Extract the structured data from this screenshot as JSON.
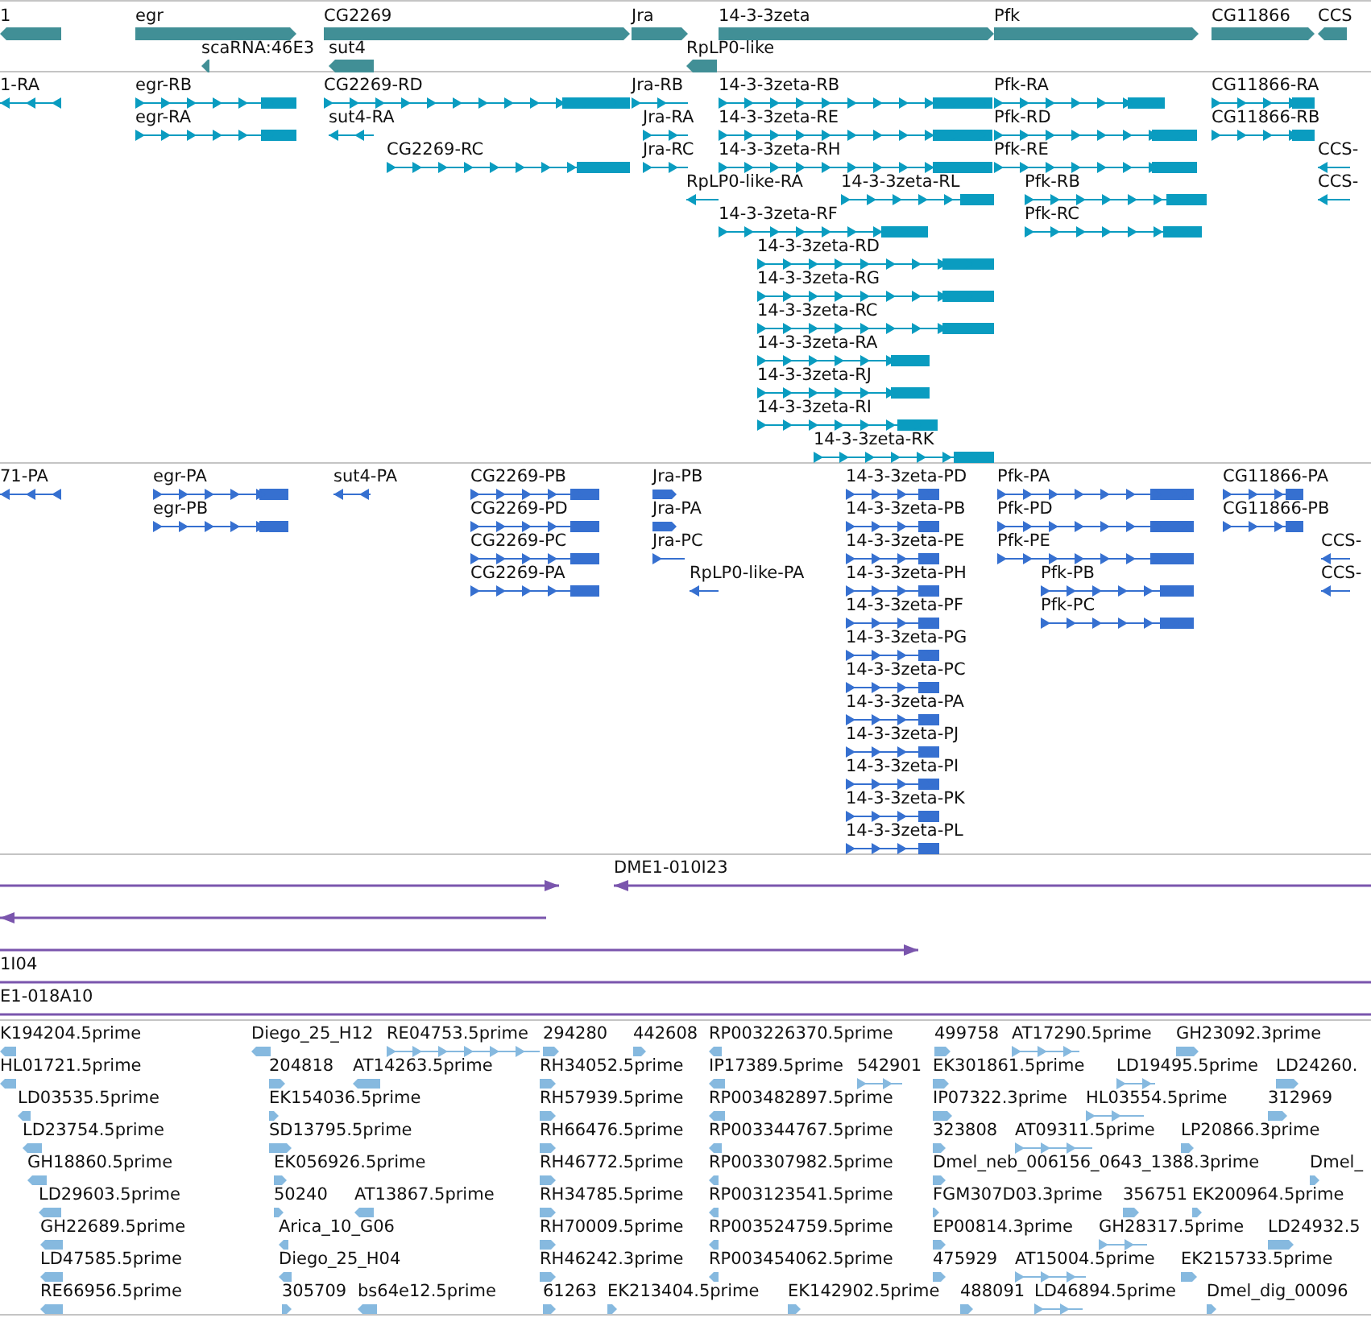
{
  "tracks": [
    {
      "kind": "gene",
      "rows": [
        {
          "features": [
            {
              "label": "1",
              "reverse": true
            },
            {
              "label": "egr",
              "reverse": false
            },
            {
              "label": "CG2269",
              "reverse": false
            },
            {
              "label": "Jra",
              "reverse": false
            },
            {
              "label": "14-3-3zeta",
              "reverse": false
            },
            {
              "label": "Pfk",
              "reverse": false
            },
            {
              "label": "CG11866",
              "reverse": false
            },
            {
              "label": "CCS",
              "reverse": true
            }
          ]
        },
        {
          "features": [
            {
              "label": "scaRNA:46E3",
              "reverse": true
            },
            {
              "label": "sut4",
              "reverse": true
            },
            {
              "label": "RpLP0-like",
              "reverse": true
            }
          ]
        }
      ]
    },
    {
      "kind": "transcript",
      "rows": [
        {
          "features": [
            {
              "label": "1-RA",
              "reverse": true
            },
            {
              "label": "egr-RB",
              "reverse": false
            },
            {
              "label": "CG2269-RD",
              "reverse": false
            },
            {
              "label": "Jra-RB",
              "reverse": false
            },
            {
              "label": "14-3-3zeta-RB",
              "reverse": false
            },
            {
              "label": "Pfk-RA",
              "reverse": false
            },
            {
              "label": "CG11866-RA",
              "reverse": false
            }
          ]
        },
        {
          "features": [
            {
              "label": "egr-RA",
              "reverse": false
            },
            {
              "label": "sut4-RA",
              "reverse": true
            },
            {
              "label": "Jra-RA",
              "reverse": false
            },
            {
              "label": "14-3-3zeta-RE",
              "reverse": false
            },
            {
              "label": "Pfk-RD",
              "reverse": false
            },
            {
              "label": "CG11866-RB",
              "reverse": false
            }
          ]
        },
        {
          "features": [
            {
              "label": "CG2269-RC",
              "reverse": false
            },
            {
              "label": "Jra-RC",
              "reverse": false
            },
            {
              "label": "14-3-3zeta-RH",
              "reverse": false
            },
            {
              "label": "Pfk-RE",
              "reverse": false
            },
            {
              "label": "CCS-",
              "reverse": true
            }
          ]
        },
        {
          "features": [
            {
              "label": "RpLP0-like-RA",
              "reverse": true
            },
            {
              "label": "14-3-3zeta-RL",
              "reverse": false
            },
            {
              "label": "Pfk-RB",
              "reverse": false
            },
            {
              "label": "CCS-",
              "reverse": true
            }
          ]
        },
        {
          "features": [
            {
              "label": "14-3-3zeta-RF",
              "reverse": false
            },
            {
              "label": "Pfk-RC",
              "reverse": false
            }
          ]
        },
        {
          "features": [
            {
              "label": "14-3-3zeta-RD",
              "reverse": false
            }
          ]
        },
        {
          "features": [
            {
              "label": "14-3-3zeta-RG",
              "reverse": false
            }
          ]
        },
        {
          "features": [
            {
              "label": "14-3-3zeta-RC",
              "reverse": false
            }
          ]
        },
        {
          "features": [
            {
              "label": "14-3-3zeta-RA",
              "reverse": false
            }
          ]
        },
        {
          "features": [
            {
              "label": "14-3-3zeta-RJ",
              "reverse": false
            }
          ]
        },
        {
          "features": [
            {
              "label": "14-3-3zeta-RI",
              "reverse": false
            }
          ]
        },
        {
          "features": [
            {
              "label": "14-3-3zeta-RK",
              "reverse": false
            }
          ]
        }
      ]
    },
    {
      "kind": "protein",
      "rows": [
        {
          "features": [
            {
              "label": "71-PA",
              "reverse": true
            },
            {
              "label": "egr-PA",
              "reverse": false
            },
            {
              "label": "sut4-PA",
              "reverse": true
            },
            {
              "label": "CG2269-PB",
              "reverse": false
            },
            {
              "label": "Jra-PB",
              "reverse": false
            },
            {
              "label": "14-3-3zeta-PD",
              "reverse": false
            },
            {
              "label": "Pfk-PA",
              "reverse": false
            },
            {
              "label": "CG11866-PA",
              "reverse": false
            }
          ]
        },
        {
          "features": [
            {
              "label": "egr-PB",
              "reverse": false
            },
            {
              "label": "CG2269-PD",
              "reverse": false
            },
            {
              "label": "Jra-PA",
              "reverse": false
            },
            {
              "label": "14-3-3zeta-PB",
              "reverse": false
            },
            {
              "label": "Pfk-PD",
              "reverse": false
            },
            {
              "label": "CG11866-PB",
              "reverse": false
            }
          ]
        },
        {
          "features": [
            {
              "label": "CG2269-PC",
              "reverse": false
            },
            {
              "label": "Jra-PC",
              "reverse": false
            },
            {
              "label": "14-3-3zeta-PE",
              "reverse": false
            },
            {
              "label": "Pfk-PE",
              "reverse": false
            },
            {
              "label": "CCS-",
              "reverse": true
            }
          ]
        },
        {
          "features": [
            {
              "label": "CG2269-PA",
              "reverse": false
            },
            {
              "label": "RpLP0-like-PA",
              "reverse": true
            },
            {
              "label": "14-3-3zeta-PH",
              "reverse": false
            },
            {
              "label": "Pfk-PB",
              "reverse": false
            },
            {
              "label": "CCS-",
              "reverse": true
            }
          ]
        },
        {
          "features": [
            {
              "label": "14-3-3zeta-PF",
              "reverse": false
            },
            {
              "label": "Pfk-PC",
              "reverse": false
            }
          ]
        },
        {
          "features": [
            {
              "label": "14-3-3zeta-PG",
              "reverse": false
            }
          ]
        },
        {
          "features": [
            {
              "label": "14-3-3zeta-PC",
              "reverse": false
            }
          ]
        },
        {
          "features": [
            {
              "label": "14-3-3zeta-PA",
              "reverse": false
            }
          ]
        },
        {
          "features": [
            {
              "label": "14-3-3zeta-PJ",
              "reverse": false
            }
          ]
        },
        {
          "features": [
            {
              "label": "14-3-3zeta-PI",
              "reverse": false
            }
          ]
        },
        {
          "features": [
            {
              "label": "14-3-3zeta-PK",
              "reverse": false
            }
          ]
        },
        {
          "features": [
            {
              "label": "14-3-3zeta-PL",
              "reverse": false
            }
          ]
        }
      ]
    },
    {
      "kind": "clone",
      "rows": [
        {
          "features": [
            {
              "reverse": false
            },
            {
              "label": "DME1-010I23",
              "reverse": true
            }
          ]
        },
        {
          "features": [
            {
              "reverse": true
            }
          ]
        },
        {
          "features": [
            {
              "reverse": false
            }
          ]
        },
        {
          "features": [
            {
              "label": "1I04"
            }
          ]
        },
        {
          "features": [
            {
              "label": "E1-018A10"
            }
          ]
        }
      ]
    },
    {
      "kind": "est",
      "rows": [
        {
          "features": [
            {
              "label": "K194204.5prime",
              "reverse": true
            },
            {
              "label": "Diego_25_H12",
              "reverse": true
            },
            {
              "label": "RE04753.5prime",
              "reverse": false
            },
            {
              "label": "294280",
              "reverse": false
            },
            {
              "label": "442608",
              "reverse": false
            },
            {
              "label": "RP003226370.5prime",
              "reverse": true
            },
            {
              "label": "499758",
              "reverse": false
            },
            {
              "label": "AT17290.5prime",
              "reverse": false
            },
            {
              "label": "GH23092.3prime",
              "reverse": false
            }
          ]
        },
        {
          "features": [
            {
              "label": "HL01721.5prime",
              "reverse": true
            },
            {
              "label": "204818",
              "reverse": false
            },
            {
              "label": "AT14263.5prime",
              "reverse": true
            },
            {
              "label": "RH34052.5prime",
              "reverse": false
            },
            {
              "label": "IP17389.5prime",
              "reverse": true
            },
            {
              "label": "542901",
              "reverse": false
            },
            {
              "label": "EK301861.5prime",
              "reverse": false
            },
            {
              "label": "LD19495.5prime",
              "reverse": false
            },
            {
              "label": "LD24260.",
              "reverse": false
            }
          ]
        },
        {
          "features": [
            {
              "label": "LD03535.5prime",
              "reverse": true
            },
            {
              "label": "EK154036.5prime",
              "reverse": false
            },
            {
              "label": "RH57939.5prime",
              "reverse": false
            },
            {
              "label": "RP003482897.5prime",
              "reverse": true
            },
            {
              "label": "IP07322.3prime",
              "reverse": false
            },
            {
              "label": "HL03554.5prime",
              "reverse": false
            },
            {
              "label": "312969",
              "reverse": false
            }
          ]
        },
        {
          "features": [
            {
              "label": "LD23754.5prime",
              "reverse": true
            },
            {
              "label": "SD13795.5prime",
              "reverse": false
            },
            {
              "label": "RH66476.5prime",
              "reverse": false
            },
            {
              "label": "RP003344767.5prime",
              "reverse": true
            },
            {
              "label": "323808",
              "reverse": false
            },
            {
              "label": "AT09311.5prime",
              "reverse": false
            },
            {
              "label": "LP20866.3prime",
              "reverse": false
            }
          ]
        },
        {
          "features": [
            {
              "label": "GH18860.5prime",
              "reverse": true
            },
            {
              "label": "EK056926.5prime",
              "reverse": false
            },
            {
              "label": "RH46772.5prime",
              "reverse": false
            },
            {
              "label": "RP003307982.5prime",
              "reverse": true
            },
            {
              "label": "Dmel_neb_006156_0643_1388.3prime",
              "reverse": false
            },
            {
              "label": "Dmel_",
              "reverse": false
            }
          ]
        },
        {
          "features": [
            {
              "label": "LD29603.5prime",
              "reverse": true
            },
            {
              "label": "50240",
              "reverse": false
            },
            {
              "label": "AT13867.5prime",
              "reverse": true
            },
            {
              "label": "RH34785.5prime",
              "reverse": false
            },
            {
              "label": "RP003123541.5prime",
              "reverse": true
            },
            {
              "label": "FGM307D03.3prime",
              "reverse": false
            },
            {
              "label": "356751",
              "reverse": false
            },
            {
              "label": "EK200964.5prime",
              "reverse": false
            }
          ]
        },
        {
          "features": [
            {
              "label": "GH22689.5prime",
              "reverse": true
            },
            {
              "label": "Arica_10_G06",
              "reverse": true
            },
            {
              "label": "RH70009.5prime",
              "reverse": false
            },
            {
              "label": "RP003524759.5prime",
              "reverse": true
            },
            {
              "label": "EP00814.3prime",
              "reverse": false
            },
            {
              "label": "GH28317.5prime",
              "reverse": false
            },
            {
              "label": "LD24932.5",
              "reverse": false
            }
          ]
        },
        {
          "features": [
            {
              "label": "LD47585.5prime",
              "reverse": true
            },
            {
              "label": "Diego_25_H04",
              "reverse": true
            },
            {
              "label": "RH46242.3prime",
              "reverse": false
            },
            {
              "label": "RP003454062.5prime",
              "reverse": true
            },
            {
              "label": "475929",
              "reverse": false
            },
            {
              "label": "AT15004.5prime",
              "reverse": false
            },
            {
              "label": "EK215733.5prime",
              "reverse": false
            }
          ]
        },
        {
          "features": [
            {
              "label": "RE66956.5prime",
              "reverse": true
            },
            {
              "label": "305709",
              "reverse": false
            },
            {
              "label": "bs64e12.5prime",
              "reverse": true
            },
            {
              "label": "61263",
              "reverse": false
            },
            {
              "label": "EK213404.5prime",
              "reverse": false
            },
            {
              "label": "EK142902.5prime",
              "reverse": false
            },
            {
              "label": "488091",
              "reverse": false
            },
            {
              "label": "LD46894.5prime",
              "reverse": false
            },
            {
              "label": "Dmel_dig_00096",
              "reverse": false
            }
          ]
        }
      ]
    }
  ]
}
